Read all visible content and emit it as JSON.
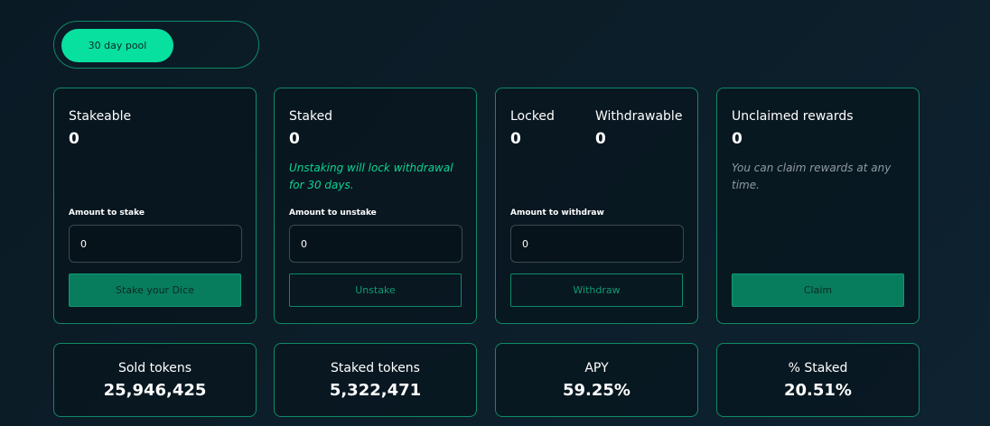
{
  "pool_toggle": {
    "active_label": "30 day pool"
  },
  "stake_card": {
    "label": "Stakeable",
    "value": "0",
    "field_label": "Amount to stake",
    "input_value": "0",
    "button_label": "Stake your Dice"
  },
  "unstake_card": {
    "label": "Staked",
    "value": "0",
    "note": "Unstaking will lock withdrawal for 30 days.",
    "field_label": "Amount to unstake",
    "input_value": "0",
    "button_label": "Unstake"
  },
  "withdraw_card": {
    "locked_label": "Locked",
    "locked_value": "0",
    "withdrawable_label": "Withdrawable",
    "withdrawable_value": "0",
    "field_label": "Amount to withdraw",
    "input_value": "0",
    "button_label": "Withdraw"
  },
  "rewards_card": {
    "label": "Unclaimed rewards",
    "value": "0",
    "note": "You can claim rewards at any time.",
    "button_label": "Claim"
  },
  "stats": [
    {
      "label": "Sold tokens",
      "value": "25,946,425"
    },
    {
      "label": "Staked tokens",
      "value": "5,322,471"
    },
    {
      "label": "APY",
      "value": "59.25%"
    },
    {
      "label": "% Staked",
      "value": "20.51%"
    }
  ],
  "colors": {
    "accent": "#08e0a0",
    "border": "#0f8a66",
    "button_fill": "#087d5e",
    "note_green": "#0fd394",
    "background": "#0c1d28"
  }
}
